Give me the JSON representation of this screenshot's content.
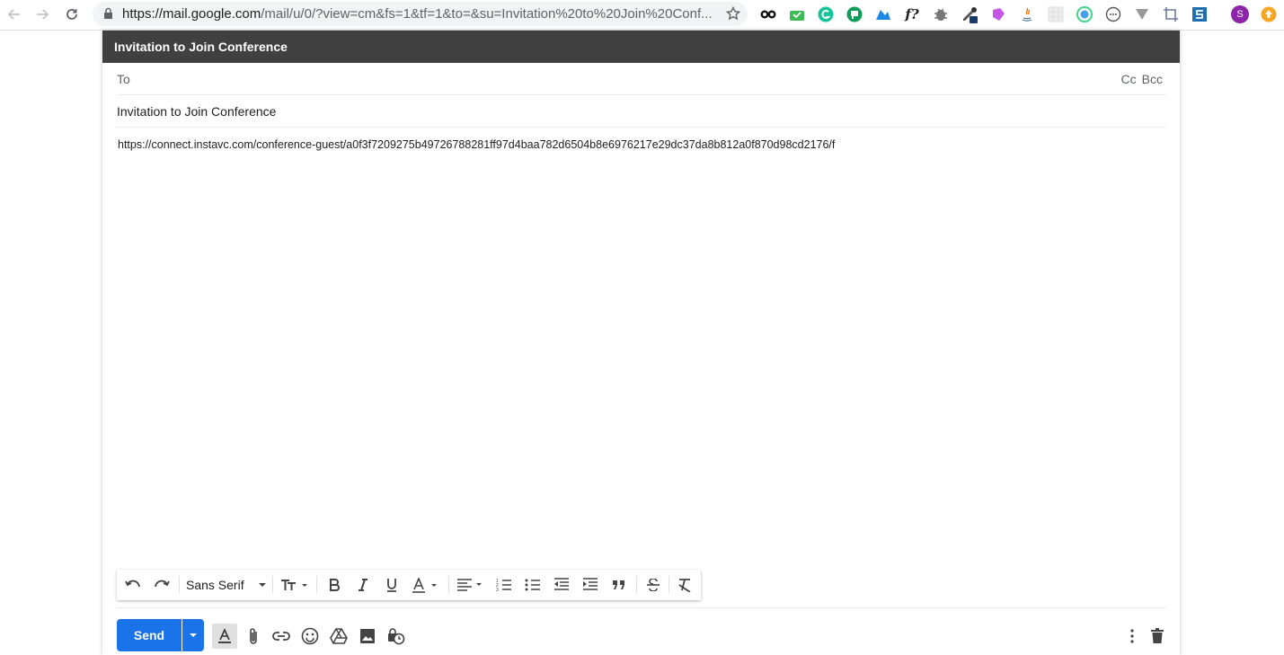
{
  "browser": {
    "url_host": "https://mail.google.com",
    "url_path": "/mail/u/0/?view=cm&fs=1&tf=1&to=&su=Invitation%20to%20Join%20Conf...",
    "profile_initial": "S"
  },
  "compose": {
    "title": "Invitation to Join Conference",
    "to_label": "To",
    "cc_label": "Cc",
    "bcc_label": "Bcc",
    "subject": "Invitation to Join Conference",
    "body": "https://connect.instavc.com/conference-guest/a0f3f7209275b49726788281ff97d4baa782d6504b8e6976217e29dc37da8b812a0f870d98cd2176/f"
  },
  "format_bar": {
    "font_name": "Sans Serif"
  },
  "footer": {
    "send_label": "Send"
  },
  "colors": {
    "header_bg": "#404040",
    "send_blue": "#1a73e8"
  }
}
